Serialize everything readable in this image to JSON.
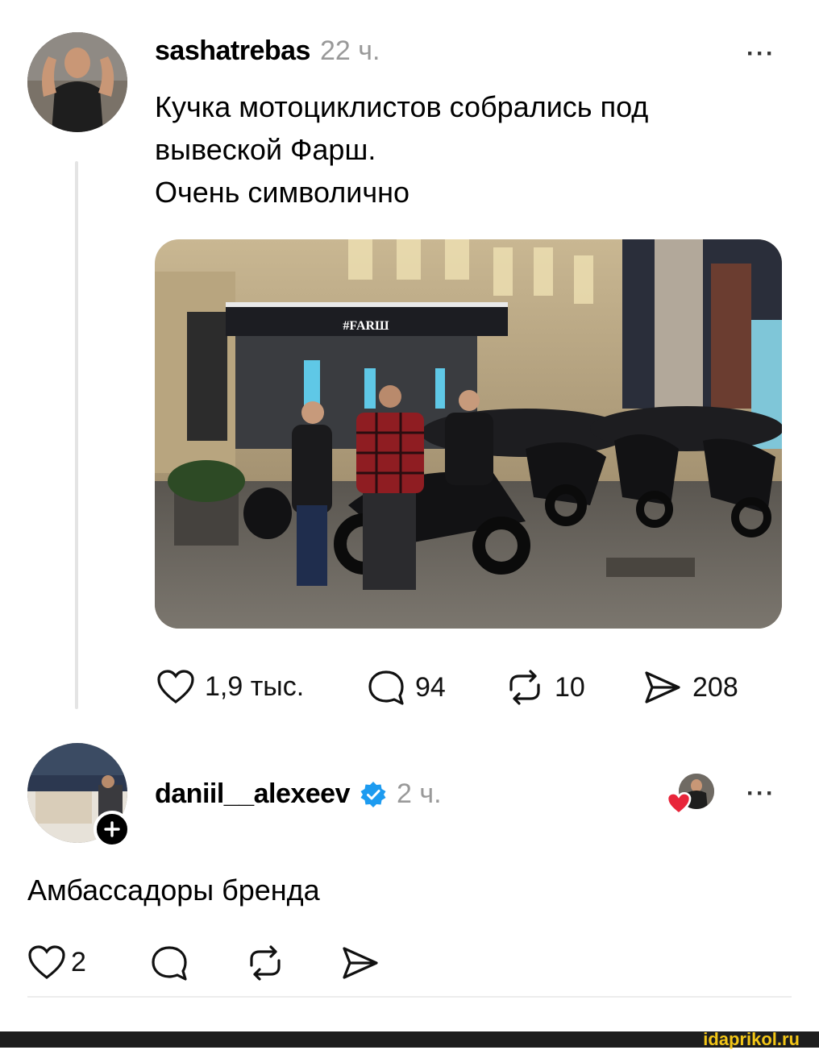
{
  "post": {
    "username": "sashatrebas",
    "time": "22 ч.",
    "more": "···",
    "text_lines": [
      "Кучка мотоциклистов собрались под",
      "вывеской Фарш.",
      "Очень символично"
    ],
    "photo_sign": "#FARШ",
    "actions": {
      "likes": "1,9 тыс.",
      "comments": "94",
      "reposts": "10",
      "shares": "208"
    }
  },
  "reply": {
    "username": "daniil__alexeev",
    "time": "2 ч.",
    "more": "···",
    "text": "Амбассадоры бренда",
    "likes": "2"
  },
  "footer": {
    "watermark": "idaprikol.ru"
  },
  "colors": {
    "verified": "#1d9bf0",
    "liked_heart": "#e8253a",
    "muted": "#999999",
    "footer_bg": "#1d1d1d",
    "watermark": "#f3c617"
  }
}
